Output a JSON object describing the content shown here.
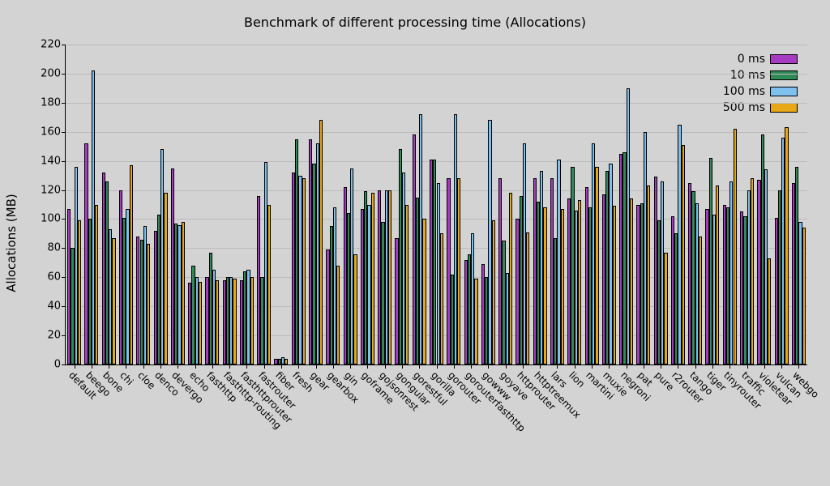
{
  "chart_data": {
    "type": "bar",
    "title": "Benchmark of different processing time (Allocations)",
    "xlabel": "",
    "ylabel": "Allocations (MB)",
    "ylim": [
      0,
      220
    ],
    "yticks": [
      0,
      20,
      40,
      60,
      80,
      100,
      120,
      140,
      160,
      180,
      200,
      220
    ],
    "legend_position": "upper right",
    "grid": true,
    "categories": [
      "default",
      "beego",
      "bone",
      "chi",
      "cloe",
      "denco",
      "devergo",
      "echo",
      "fasthttp",
      "fasthttp-routing",
      "fasthttprouter",
      "fastrouter",
      "fiber",
      "fresh",
      "gear",
      "gearbox",
      "gin",
      "goframe",
      "gojsonrest",
      "gongular",
      "gorestful",
      "gorilla",
      "gorouter",
      "gorouterfasthttp",
      "gowww",
      "goyave",
      "httprouter",
      "httptreemux",
      "lars",
      "lion",
      "martini",
      "muxie",
      "negroni",
      "pat",
      "pure",
      "r2router",
      "tango",
      "tiger",
      "tinyrouter",
      "traffic",
      "violetear",
      "vulcan",
      "webgo"
    ],
    "series": [
      {
        "name": "0 ms",
        "values": [
          107,
          152,
          132,
          120,
          88,
          92,
          135,
          56,
          60,
          58,
          58,
          116,
          4,
          132,
          155,
          79,
          122,
          107,
          120,
          87,
          158,
          141,
          128,
          72,
          69,
          128,
          100,
          128,
          128,
          114,
          122,
          117,
          145,
          110,
          129,
          102,
          125,
          107,
          110,
          105,
          127,
          101,
          125
        ]
      },
      {
        "name": "10 ms",
        "values": [
          80,
          100,
          126,
          101,
          86,
          103,
          97,
          68,
          77,
          60,
          64,
          60,
          4,
          155,
          138,
          95,
          104,
          119,
          98,
          148,
          115,
          141,
          62,
          76,
          60,
          85,
          116,
          112,
          87,
          136,
          108,
          133,
          146,
          111,
          99,
          90,
          119,
          142,
          108,
          102,
          158,
          120,
          136
        ]
      },
      {
        "name": "100 ms",
        "values": [
          136,
          202,
          93,
          107,
          95,
          148,
          96,
          60,
          65,
          60,
          65,
          139,
          5,
          130,
          152,
          108,
          135,
          110,
          120,
          132,
          172,
          125,
          172,
          90,
          168,
          63,
          152,
          133,
          141,
          106,
          152,
          138,
          190,
          160,
          126,
          165,
          111,
          103,
          126,
          120,
          134,
          156,
          98
        ]
      },
      {
        "name": "500 ms",
        "values": [
          99,
          110,
          87,
          137,
          83,
          118,
          98,
          57,
          58,
          59,
          60,
          110,
          4,
          128,
          168,
          68,
          76,
          118,
          120,
          110,
          100,
          90,
          128,
          59,
          99,
          118,
          91,
          108,
          107,
          113,
          136,
          109,
          114,
          123,
          77,
          151,
          88,
          123,
          162,
          128,
          73,
          163,
          94
        ]
      }
    ],
    "colors": [
      "#a63bc2",
      "#2e8b57",
      "#7ec0ee",
      "#e6a817"
    ]
  }
}
